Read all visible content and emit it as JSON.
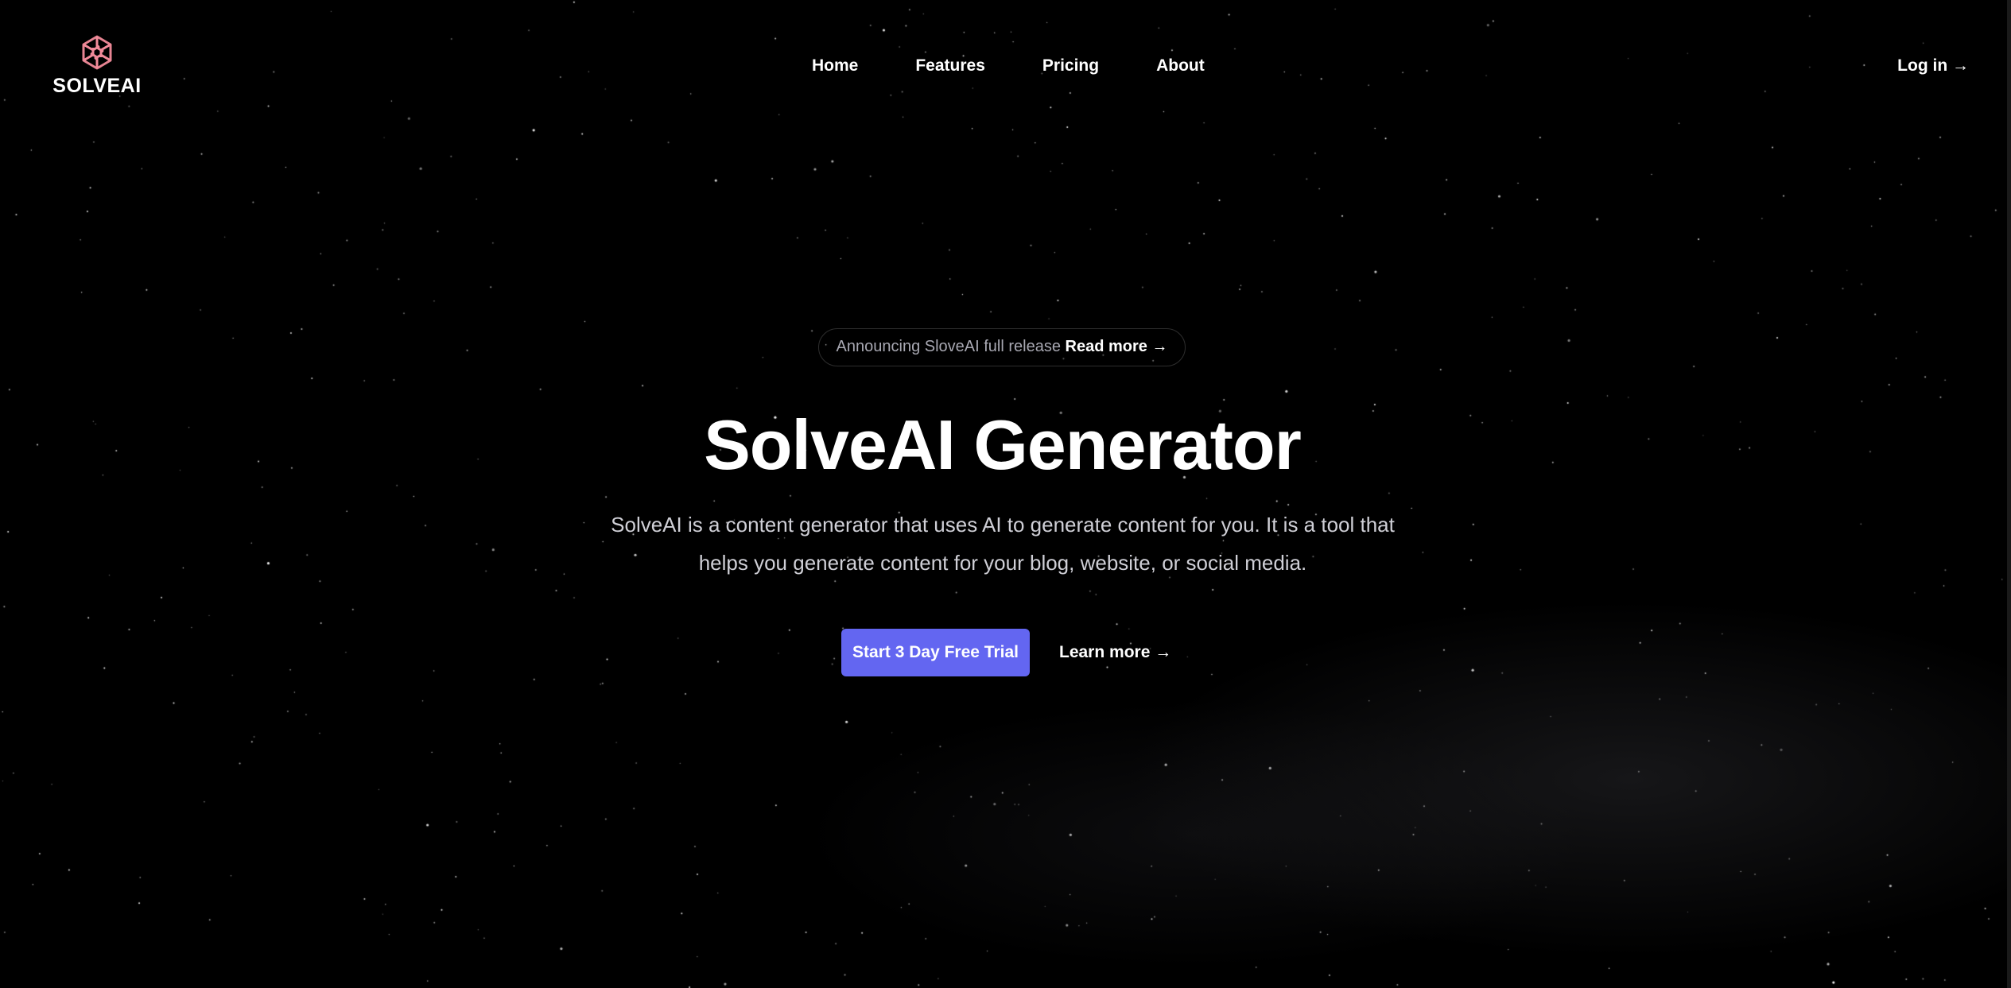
{
  "brand": {
    "name": "SOLVEAI",
    "logo_icon": "hexagon-swirl-logo-icon",
    "logo_color": "#f28b9a"
  },
  "nav": {
    "items": [
      {
        "label": "Home"
      },
      {
        "label": "Features"
      },
      {
        "label": "Pricing"
      },
      {
        "label": "About"
      }
    ],
    "login_label": "Log in →"
  },
  "hero": {
    "announcement": {
      "text": "Announcing SloveAI full release",
      "link_label": "Read more →"
    },
    "title": "SolveAI Generator",
    "description": "SolveAI is a content generator that uses AI to generate content for you. It is a tool that helps you generate content for your blog, website, or social media.",
    "primary_cta": "Start 3 Day Free Trial",
    "secondary_cta": "Learn more →"
  },
  "colors": {
    "background": "#000000",
    "accent": "#6366f1",
    "text": "#ffffff",
    "muted_text": "#cfcfd6"
  }
}
